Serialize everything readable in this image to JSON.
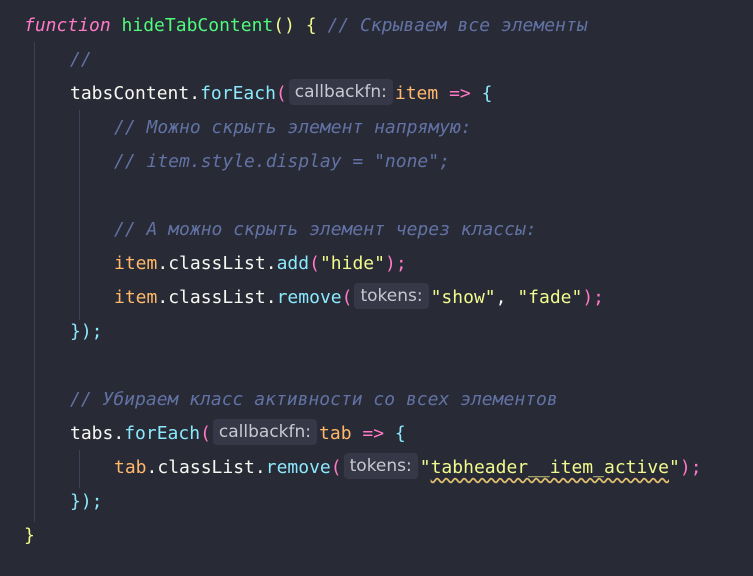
{
  "colors": {
    "background": "#282a36",
    "keyword": "#ff79c6",
    "function_name": "#50fa7b",
    "method": "#8be9fd",
    "parameter": "#ffb86c",
    "string": "#f1fa8c",
    "comment": "#6272a4"
  },
  "code": {
    "l1": {
      "kw": "function",
      "name": "hideTabContent",
      "parens": "()",
      "brace": "{",
      "comment": "// Скрываем все элементы"
    },
    "l2": {
      "comment": "//"
    },
    "l3": {
      "obj": "tabsContent",
      "dot": ".",
      "method": "forEach",
      "open": "(",
      "hint": "callbackfn:",
      "param": "item",
      "arrow": "=>",
      "brace": "{"
    },
    "l4": {
      "comment": "// Можно скрыть элемент напрямую:"
    },
    "l5": {
      "comment": "// item.style.display = \"none\";"
    },
    "l7": {
      "comment": "// А можно скрыть элемент через классы:"
    },
    "l8": {
      "obj": "item",
      "dot1": ".",
      "prop": "classList",
      "dot2": ".",
      "method": "add",
      "open": "(",
      "str": "\"hide\"",
      "close": ");"
    },
    "l9": {
      "obj": "item",
      "dot1": ".",
      "prop": "classList",
      "dot2": ".",
      "method": "remove",
      "open": "(",
      "hint": "tokens:",
      "str1": "\"show\"",
      "comma": ",",
      "str2": "\"fade\"",
      "close": ");"
    },
    "l10": {
      "close": "});"
    },
    "l12": {
      "comment": "// Убираем класс активности со всех элементов"
    },
    "l13": {
      "obj": "tabs",
      "dot": ".",
      "method": "forEach",
      "open": "(",
      "hint": "callbackfn:",
      "param": "tab",
      "arrow": "=>",
      "brace": "{"
    },
    "l14": {
      "obj": "tab",
      "dot1": ".",
      "prop": "classList",
      "dot2": ".",
      "method": "remove",
      "open": "(",
      "hint": "tokens:",
      "str_quote_open": "\"",
      "str_body": "tabheader__item_active",
      "str_quote_close": "\"",
      "close": ");"
    },
    "l15": {
      "close": "});"
    },
    "l16": {
      "close": "}"
    }
  }
}
